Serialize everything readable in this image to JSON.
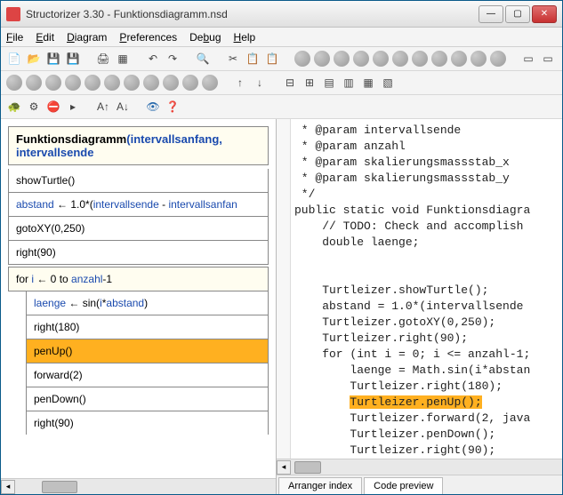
{
  "window": {
    "title": "Structorizer 3.30 - Funktionsdiagramm.nsd"
  },
  "menu": {
    "file": "File",
    "edit": "Edit",
    "diagram": "Diagram",
    "preferences": "Preferences",
    "debug": "Debug",
    "help": "Help"
  },
  "diagram": {
    "header_name": "Funktionsdiagramm",
    "header_params": "(intervallsanfang, intervallsende",
    "rows": {
      "showTurtle": "showTurtle()",
      "abstand_a": "abstand",
      "abstand_b": " ← 1.0*(",
      "abstand_c": "intervallsende",
      "abstand_d": " - ",
      "abstand_e": "intervallsanfan",
      "gotoXY": "gotoXY(0,250)",
      "right90": "right(90)",
      "for_a": "for ",
      "for_b": "i",
      "for_c": " ← 0 to ",
      "for_d": "anzahl",
      "for_e": "-1",
      "laenge_a": "laenge",
      "laenge_b": " ← sin(",
      "laenge_c": "i",
      "laenge_d": "*",
      "laenge_e": "abstand",
      "laenge_f": ")",
      "right180": "right(180)",
      "penUp": "penUp()",
      "forward2": "forward(2)",
      "penDown": "penDown()",
      "right90b": "right(90)"
    }
  },
  "code": {
    "l1": " * @param intervallsende",
    "l2": " * @param anzahl",
    "l3": " * @param skalierungsmassstab_x",
    "l4": " * @param skalierungsmassstab_y",
    "l5": " */",
    "l6": "public static void Funktionsdiagra",
    "l7": "    // TODO: Check and accomplish ",
    "l8": "    double laenge;",
    "l9": "",
    "l10": "",
    "l11": "    Turtleizer.showTurtle();",
    "l12": "    abstand = 1.0*(intervallsende ",
    "l13": "    Turtleizer.gotoXY(0,250);",
    "l14": "    Turtleizer.right(90);",
    "l15": "    for (int i = 0; i <= anzahl-1;",
    "l16": "        laenge = Math.sin(i*abstan",
    "l17": "        Turtleizer.right(180);",
    "l18a": "        ",
    "l18b": "Turtleizer.penUp();",
    "l19": "        Turtleizer.forward(2, java",
    "l20": "        Turtleizer.penDown();",
    "l21": "        Turtleizer.right(90);"
  },
  "tabs": {
    "arranger": "Arranger index",
    "code": "Code preview"
  }
}
